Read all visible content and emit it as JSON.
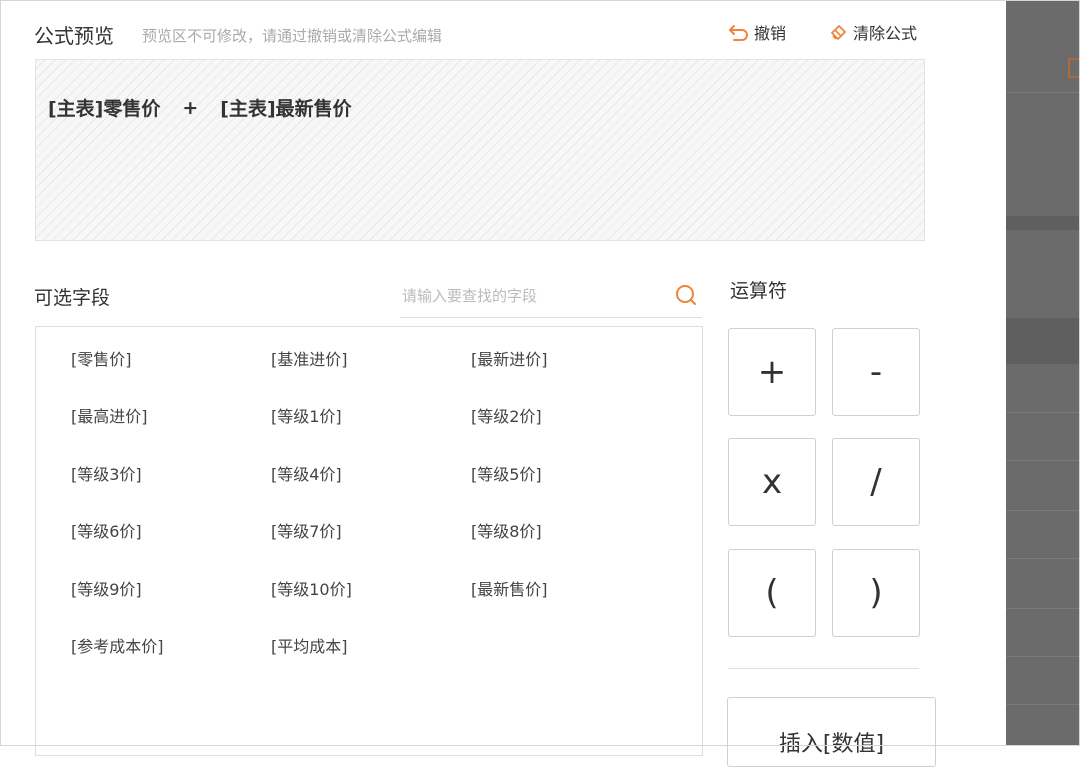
{
  "preview": {
    "title": "公式预览",
    "hint": "预览区不可修改，请通过撤销或清除公式编辑",
    "undo_label": "撤销",
    "clear_label": "清除公式",
    "formula": {
      "term1": "[主表]零售价",
      "operator": "+",
      "term2": "[主表]最新售价"
    }
  },
  "fields": {
    "title": "可选字段",
    "search_placeholder": "请输入要查找的字段",
    "items": [
      "[零售价]",
      "[基准进价]",
      "[最新进价]",
      "[最高进价]",
      "[等级1价]",
      "[等级2价]",
      "[等级3价]",
      "[等级4价]",
      "[等级5价]",
      "[等级6价]",
      "[等级7价]",
      "[等级8价]",
      "[等级9价]",
      "[等级10价]",
      "[最新售价]",
      "[参考成本价]",
      "[平均成本]"
    ]
  },
  "operators": {
    "title": "运算符",
    "buttons": [
      "+",
      "-",
      "x",
      "/",
      "(",
      ")"
    ],
    "insert_label": "插入[数值]"
  },
  "colors": {
    "accent": "#f0843c",
    "backdrop": "#6b6b6b"
  },
  "icons": {
    "undo": "undo-arrow-icon",
    "clear": "eraser-icon",
    "search": "search-icon"
  }
}
